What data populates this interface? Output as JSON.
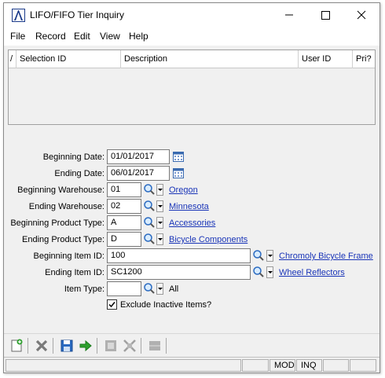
{
  "window": {
    "title": "LIFO/FIFO Tier Inquiry"
  },
  "menu": [
    "File",
    "Record",
    "Edit",
    "View",
    "Help"
  ],
  "grid": {
    "sort_marker": "/",
    "columns": [
      "Selection ID",
      "Description",
      "User ID",
      "Pri?"
    ]
  },
  "form": {
    "beginning_date": {
      "label": "Beginning Date:",
      "value": "01/01/2017"
    },
    "ending_date": {
      "label": "Ending Date:",
      "value": "06/01/2017"
    },
    "beginning_warehouse": {
      "label": "Beginning Warehouse:",
      "value": "01",
      "link": "Oregon"
    },
    "ending_warehouse": {
      "label": "Ending Warehouse:",
      "value": "02",
      "link": "Minnesota"
    },
    "beginning_product_type": {
      "label": "Beginning Product Type:",
      "value": "A",
      "link": "Accessories"
    },
    "ending_product_type": {
      "label": "Ending Product Type:",
      "value": "D",
      "link": "Bicycle Components"
    },
    "beginning_item": {
      "label": "Beginning Item ID:",
      "value": "100",
      "link": "Chromoly Bicycle Frame"
    },
    "ending_item": {
      "label": "Ending Item ID:",
      "value": "SC1200",
      "link": "Wheel Reflectors"
    },
    "item_type": {
      "label": "Item Type:",
      "value": "",
      "link": "All"
    },
    "exclude_inactive": {
      "label": "Exclude Inactive Items?",
      "checked": true
    }
  },
  "status": [
    "",
    "",
    "",
    "MOD",
    "INQ",
    "",
    ""
  ],
  "colors": {
    "link": "#1a35b8",
    "window_bg": "#f0f0f0",
    "brand": "#1a3a8a"
  }
}
